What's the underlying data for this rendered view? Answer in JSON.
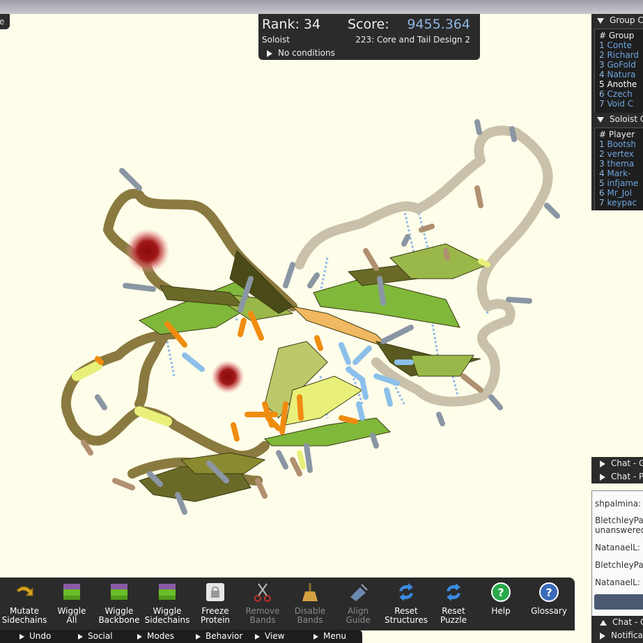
{
  "app": {
    "corner_tab_label": "e"
  },
  "score_panel": {
    "rank_label": "Rank: 34",
    "score_label": "Score:",
    "score_value": "9455.364",
    "mode": "Soloist",
    "puzzle": "223: Core and Tail Design 2",
    "conditions": "No conditions"
  },
  "group_panel": {
    "title": "Group C",
    "header": "# Group",
    "rows": [
      {
        "num": "1",
        "name": "Conte"
      },
      {
        "num": "2",
        "name": "Richard"
      },
      {
        "num": "3",
        "name": "GoFold"
      },
      {
        "num": "4",
        "name": "Natura"
      },
      {
        "num": "5",
        "name": "Anothe"
      },
      {
        "num": "6",
        "name": "Czech"
      },
      {
        "num": "7",
        "name": "Void C"
      }
    ]
  },
  "soloist_panel": {
    "title": "Soloist C",
    "header": "# Player",
    "rows": [
      {
        "num": "1",
        "name": "Bootsh"
      },
      {
        "num": "2",
        "name": "vertex"
      },
      {
        "num": "3",
        "name": "thema"
      },
      {
        "num": "4",
        "name": "Mark-"
      },
      {
        "num": "5",
        "name": "infjame"
      },
      {
        "num": "6",
        "name": "Mr_Jol"
      },
      {
        "num": "7",
        "name": "keypac"
      }
    ]
  },
  "chat": {
    "tabs": [
      "Chat - Gl",
      "Chat - Pu"
    ],
    "messages": [
      "shpalmina: ar",
      "BletchleyPar",
      "unanswered",
      "NatanaelL: w",
      "BletchleyPar",
      "NatanaelL: H"
    ],
    "bottom_tabs": [
      "Chat - G",
      "Notifica"
    ]
  },
  "toolbar": {
    "tools": [
      {
        "label1": "Mutate",
        "label2": "Sidechains",
        "icon": "mutate-arrow-icon",
        "enabled": true
      },
      {
        "label1": "Wiggle",
        "label2": "All",
        "icon": "wiggle-all-icon",
        "enabled": true
      },
      {
        "label1": "Wiggle",
        "label2": "Backbone",
        "icon": "wiggle-backbone-icon",
        "enabled": true
      },
      {
        "label1": "Wiggle",
        "label2": "Sidechains",
        "icon": "wiggle-sidechains-icon",
        "enabled": true
      },
      {
        "label1": "Freeze",
        "label2": "Protein",
        "icon": "lock-icon",
        "enabled": true
      },
      {
        "label1": "Remove",
        "label2": "Bands",
        "icon": "scissors-icon",
        "enabled": false
      },
      {
        "label1": "Disable",
        "label2": "Bands",
        "icon": "broom-icon",
        "enabled": false
      },
      {
        "label1": "Align",
        "label2": "Guide",
        "icon": "align-guide-icon",
        "enabled": false
      },
      {
        "label1": "Reset",
        "label2": "Structures",
        "icon": "reset-arrows-icon",
        "enabled": true
      },
      {
        "label1": "Reset",
        "label2": "Puzzle",
        "icon": "reset-arrows-icon",
        "enabled": true
      },
      {
        "label1": "Help",
        "label2": "",
        "icon": "help-icon",
        "enabled": true
      },
      {
        "label1": "Glossary",
        "label2": "",
        "icon": "glossary-icon",
        "enabled": true
      }
    ]
  },
  "menubar": {
    "items": [
      "Undo",
      "Social",
      "Modes",
      "Behavior",
      "View",
      "Menu"
    ]
  },
  "colors": {
    "background": "#fefde9",
    "panel": "#2b2b2b",
    "score_accent": "#8fb6e0",
    "loop_dark": "#8a7a40",
    "loop_light": "#c8c0a8",
    "sheet_green": "#7fb83a",
    "sheet_olive": "#5a5a20",
    "sidechain_orange": "#f08c10",
    "sidechain_blue": "#8cc0ea",
    "clash_red": "#a01010"
  }
}
